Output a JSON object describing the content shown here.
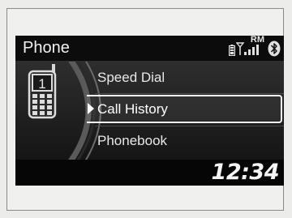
{
  "header": {
    "title": "Phone",
    "status": {
      "battery_icon": "battery-icon",
      "signal_icon": "signal-strength-icon",
      "roaming_label": "RM",
      "bluetooth_icon": "bluetooth-icon"
    }
  },
  "menu": {
    "items": [
      {
        "label": "Speed Dial",
        "selected": false
      },
      {
        "label": "Call History",
        "selected": true
      },
      {
        "label": "Phonebook",
        "selected": false
      }
    ]
  },
  "side_graphic": {
    "icon": "mobile-phone-icon",
    "number": "1"
  },
  "footer": {
    "clock": "12:34"
  },
  "colors": {
    "screen_bg": "#1a1a1a",
    "header_bg": "#0c0c0c",
    "text": "#e8e8e8",
    "highlight_border": "#f5f5f5"
  }
}
